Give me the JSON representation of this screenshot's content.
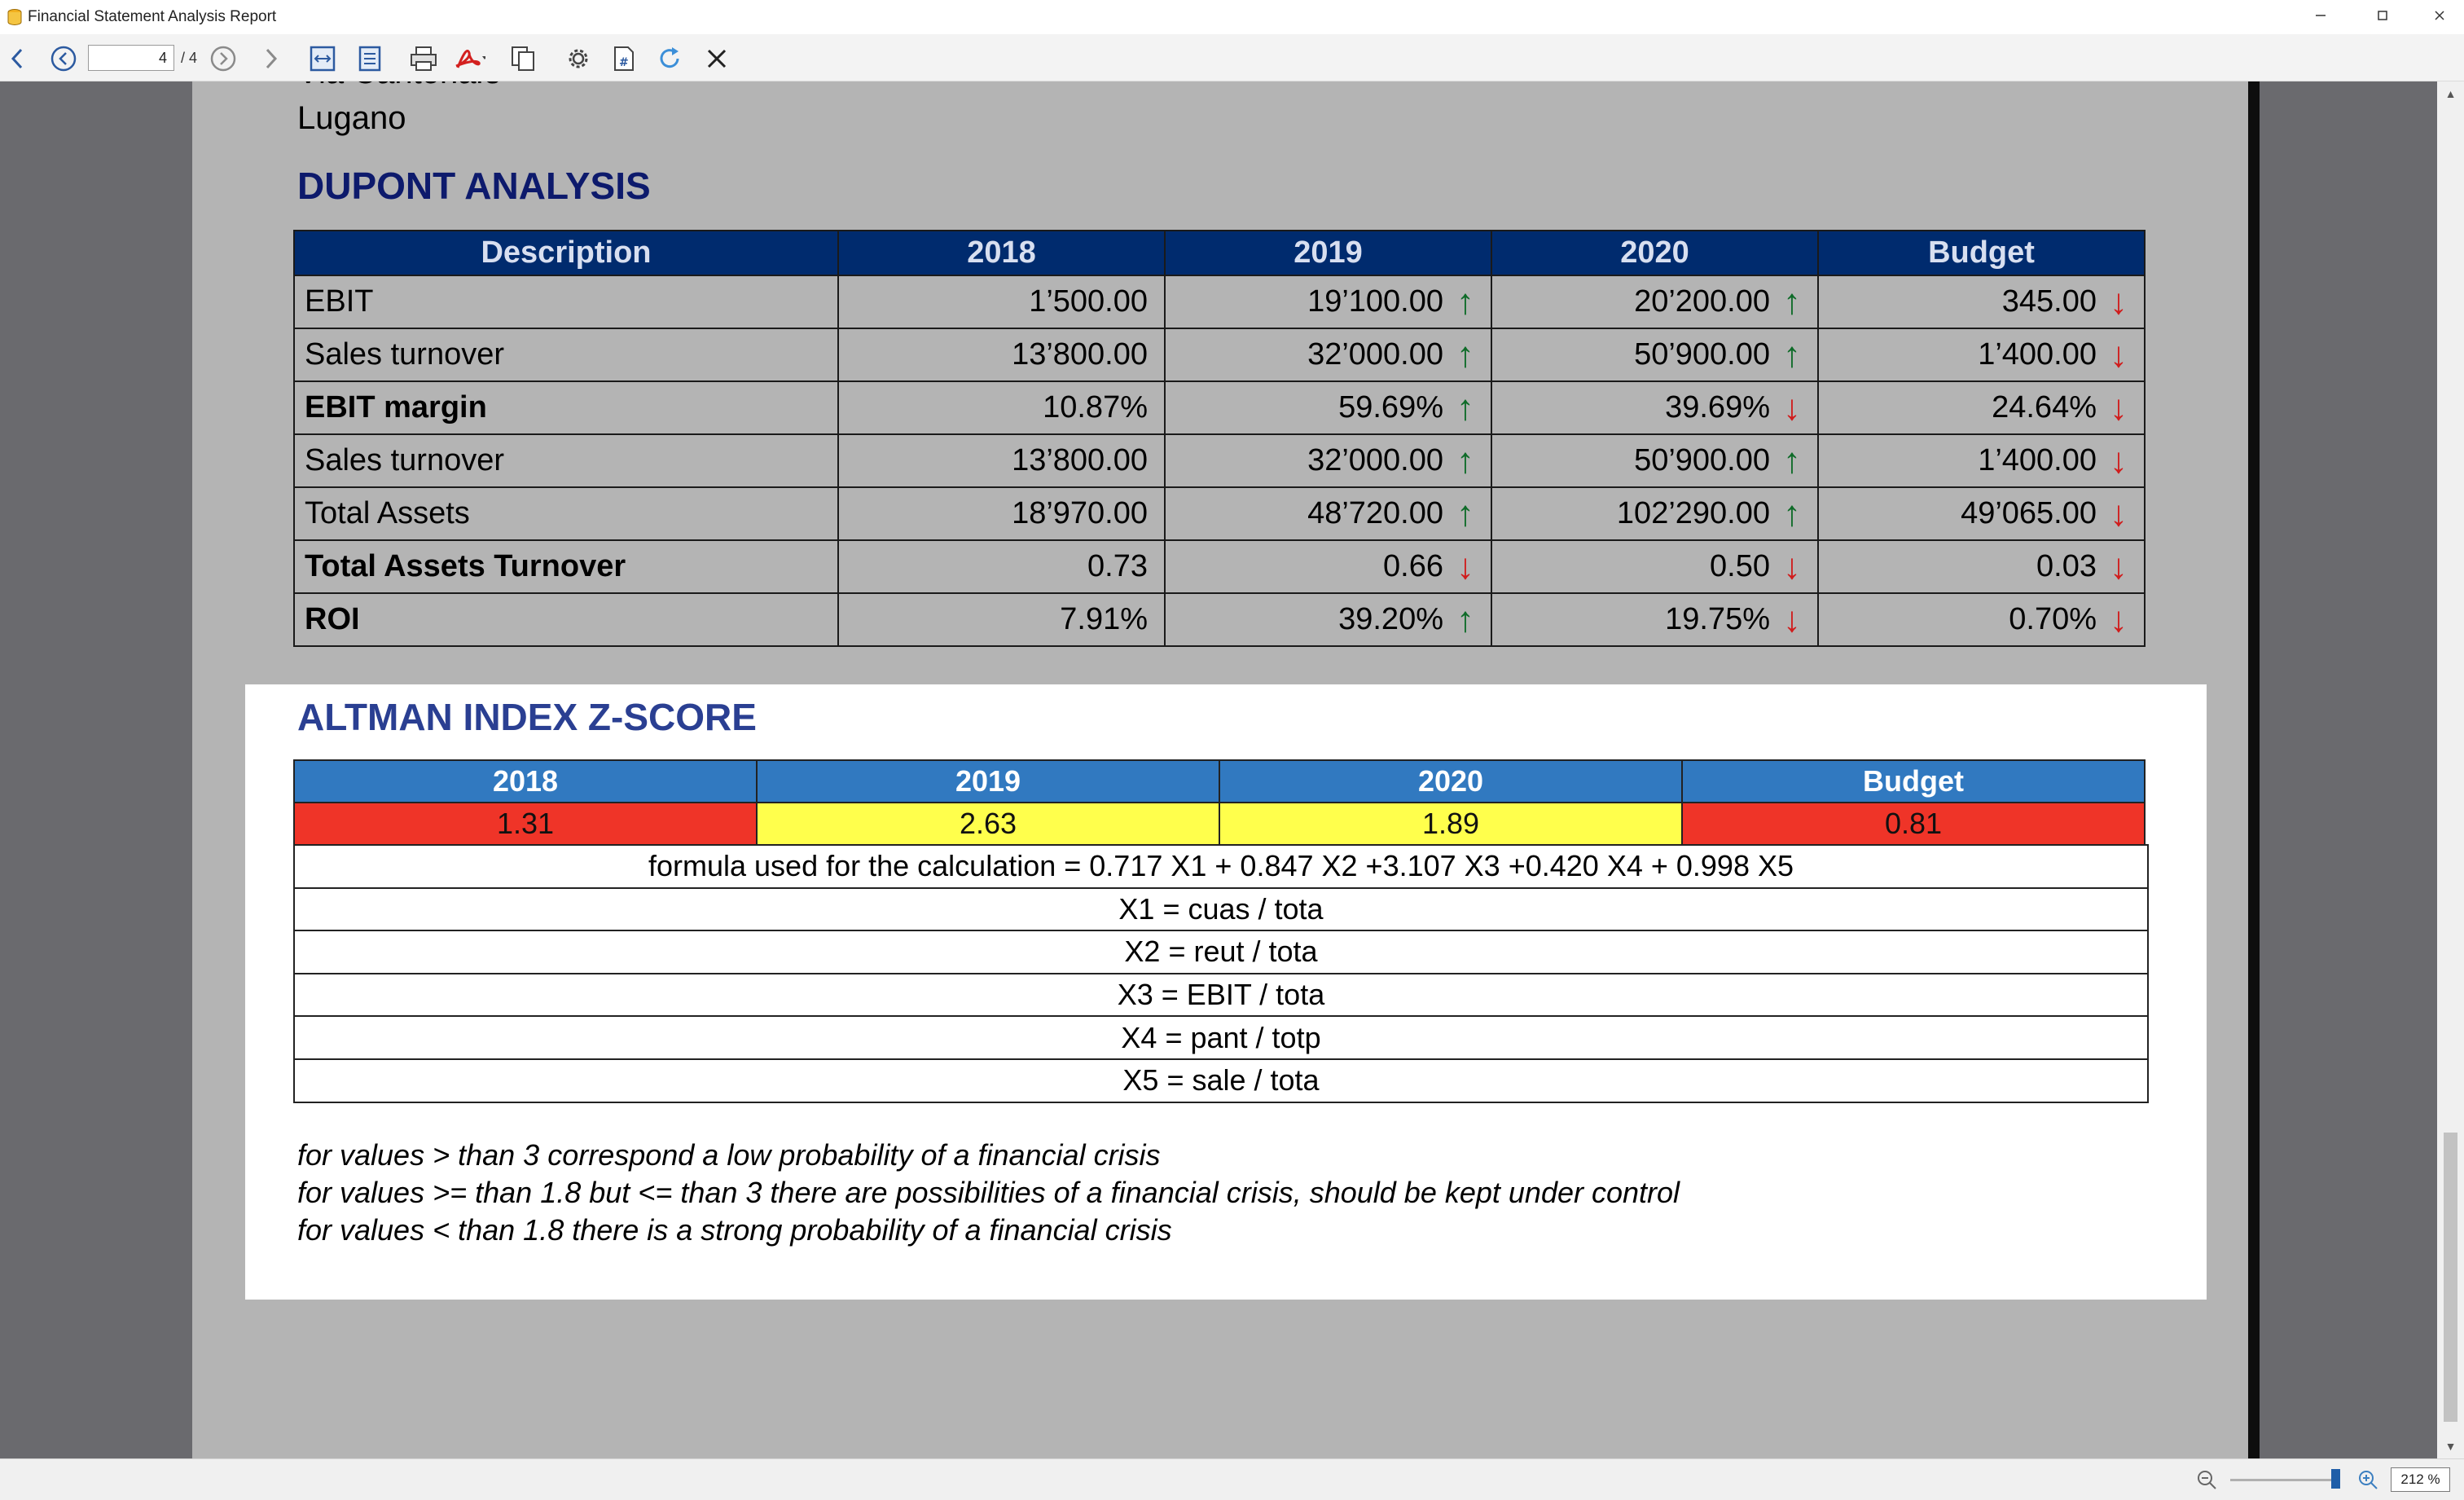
{
  "window": {
    "title": "Financial Statement Analysis Report",
    "minimize_icon": "minimize-icon",
    "maximize_icon": "maximize-icon",
    "close_icon": "close-icon"
  },
  "toolbar": {
    "page_current": "4",
    "page_total": "/ 4",
    "icons": [
      "back-arrow-icon",
      "previous-page-icon",
      "next-page-icon",
      "forward-arrow-icon",
      "fit-width-icon",
      "fit-page-icon",
      "print-icon",
      "pdf-export-icon",
      "copy-icon",
      "settings-icon",
      "page-number-icon",
      "refresh-icon",
      "close-report-icon"
    ]
  },
  "report": {
    "address_cut": "Via Cantonale",
    "address_city": "Lugano",
    "dupont": {
      "title": "DUPONT ANALYSIS",
      "headers": [
        "Description",
        "2018",
        "2019",
        "2020",
        "Budget"
      ],
      "rows": [
        {
          "desc": "EBIT",
          "bold": false,
          "values": [
            "1’500.00",
            "19’100.00",
            "20’200.00",
            "345.00"
          ],
          "trends": [
            "",
            "up",
            "up",
            "down"
          ]
        },
        {
          "desc": "Sales turnover",
          "bold": false,
          "values": [
            "13’800.00",
            "32’000.00",
            "50’900.00",
            "1’400.00"
          ],
          "trends": [
            "",
            "up",
            "up",
            "down"
          ]
        },
        {
          "desc": "EBIT margin",
          "bold": true,
          "values": [
            "10.87%",
            "59.69%",
            "39.69%",
            "24.64%"
          ],
          "trends": [
            "",
            "up",
            "down",
            "down"
          ]
        },
        {
          "desc": "Sales turnover",
          "bold": false,
          "values": [
            "13’800.00",
            "32’000.00",
            "50’900.00",
            "1’400.00"
          ],
          "trends": [
            "",
            "up",
            "up",
            "down"
          ]
        },
        {
          "desc": "Total Assets",
          "bold": false,
          "values": [
            "18’970.00",
            "48’720.00",
            "102’290.00",
            "49’065.00"
          ],
          "trends": [
            "",
            "up",
            "up",
            "down"
          ]
        },
        {
          "desc": "Total Assets Turnover",
          "bold": true,
          "values": [
            "0.73",
            "0.66",
            "0.50",
            "0.03"
          ],
          "trends": [
            "",
            "down",
            "down",
            "down"
          ]
        },
        {
          "desc": "ROI",
          "bold": true,
          "values": [
            "7.91%",
            "39.20%",
            "19.75%",
            "0.70%"
          ],
          "trends": [
            "",
            "up",
            "down",
            "down"
          ]
        }
      ],
      "trend_colors": {
        "up": "#0e6b28",
        "down": "#d01c1c"
      }
    },
    "altman": {
      "title": "ALTMAN INDEX Z-SCORE",
      "headers": [
        "2018",
        "2019",
        "2020",
        "Budget"
      ],
      "scores": [
        {
          "value": "1.31",
          "status": "red"
        },
        {
          "value": "2.63",
          "status": "yellow"
        },
        {
          "value": "1.89",
          "status": "yellow"
        },
        {
          "value": "0.81",
          "status": "red"
        }
      ],
      "status_colors": {
        "red": "#ef3428",
        "yellow": "#ffff4c"
      },
      "formula_lines": [
        "formula used for the calculation  = 0.717 X1 + 0.847 X2 +3.107 X3 +0.420 X4 + 0.998 X5",
        "X1 = cuas / tota",
        "X2 = reut / tota",
        "X3 = EBIT / tota",
        "X4 = pant / totp",
        "X5 = sale / tota"
      ],
      "notes": [
        "for values > than 3 correspond a low probability of a financial crisis",
        "for values >= than 1.8 but <= than 3 there are possibilities of a financial crisis, should be kept under control",
        "for values < than 1.8 there is a strong probability of a financial crisis"
      ]
    }
  },
  "statusbar": {
    "zoom": "212 %",
    "zoom_level_percent": 212,
    "zoom_out_icon": "zoom-out-icon",
    "zoom_in_icon": "zoom-in-icon"
  }
}
